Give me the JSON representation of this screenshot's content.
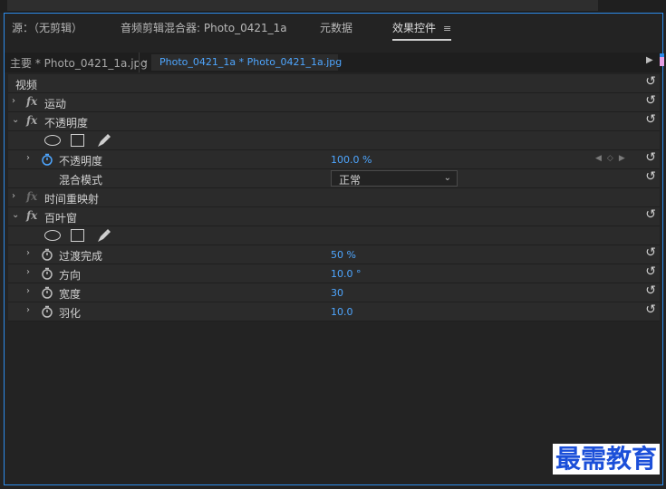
{
  "panel_tabs": [
    {
      "label": "源：（无剪辑）",
      "active": false
    },
    {
      "label": "音频剪辑混合器: Photo_0421_1a",
      "active": false
    },
    {
      "label": "元数据",
      "active": false
    },
    {
      "label": "效果控件",
      "active": true
    }
  ],
  "menu_icon": "≡",
  "sequence": {
    "master_label": "主要 * Photo_0421_1a.jpg",
    "clip_label": "Photo_0421_1a * Photo_0421_1a.jpg"
  },
  "video_header": "视频",
  "effects": {
    "motion": {
      "label": "运动"
    },
    "opacity": {
      "label": "不透明度",
      "param_label": "不透明度",
      "param_value": "100.0 %",
      "blend_label": "混合模式",
      "blend_value": "正常"
    },
    "time_remap": {
      "label": "时间重映射"
    },
    "blinds": {
      "label": "百叶窗",
      "params": [
        {
          "label": "过渡完成",
          "value": "50 %"
        },
        {
          "label": "方向",
          "value": "10.0 °"
        },
        {
          "label": "宽度",
          "value": "30"
        },
        {
          "label": "羽化",
          "value": "10.0"
        }
      ]
    }
  },
  "watermark": "最需教育",
  "colors": {
    "accent_blue": "#2d8ceb",
    "value_blue": "#4ea6ff",
    "marker_pink": "#e7a0e6",
    "watermark_blue": "#1b4fd9"
  }
}
